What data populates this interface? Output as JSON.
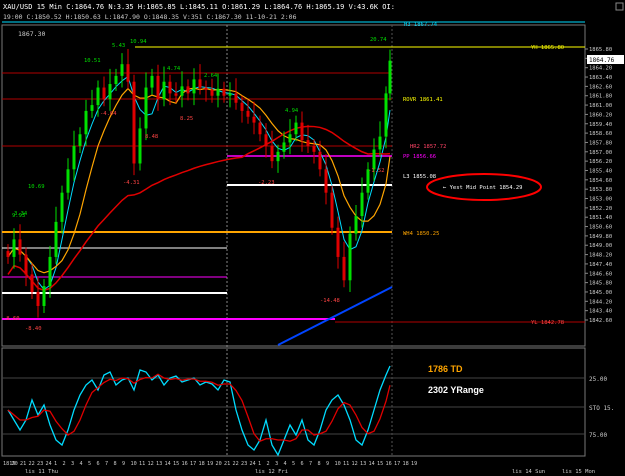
{
  "header": {
    "symbol": "XAU/USD",
    "timeframe": "15 Min",
    "quote": "C:1864.76 H:3.35 H:1865.85 L:1845.11 O:1861.29 H:1864.76 L:1845.11 ...",
    "quote_display": "XAU/USD  15 Min  C:1864.76  N:3.35  H:1865.85  L:1845.11  O:1861.29  L:1864.76  H:1865.19  V:43.6K  OI:",
    "line2": "19:00  C:1850.52  H:1850.63  L:1847.90  O:1848.35  V:351  C:1867.30  11-10-21  2:06"
  },
  "price_axis": {
    "labels": [
      "1865.80",
      "1865.00",
      "1864.76",
      "1864.20",
      "1863.40",
      "1862.60",
      "1861.80",
      "1861.00",
      "1860.20",
      "1859.40",
      "1858.60",
      "1857.80",
      "1857.00",
      "1856.20",
      "1855.40",
      "1854.60",
      "1853.80",
      "1853.00",
      "1852.20",
      "1851.40",
      "1850.60",
      "1849.80",
      "1849.00",
      "1848.20",
      "1847.40",
      "1846.60",
      "1845.80",
      "1845.00",
      "1844.20",
      "1843.40",
      "1842.60"
    ],
    "current": "1864.76",
    "osc_labels": [
      "25.00",
      "STO 15.",
      "75.00"
    ]
  },
  "levels": {
    "h3": "H3 1867.74",
    "yh": "YH 1865.80",
    "rovr": "ROVR 1861.41",
    "hr2": "HR2 1857.72",
    "pp": "PP 1856.66",
    "l3": "L3 1855.08",
    "wh4": "WH4 1850.25",
    "yl": "YL 1842.78",
    "top_left": "1867.30"
  },
  "annotations": {
    "vmp": "← Yest Mid Point 1854.29",
    "peaks": [
      "5.43",
      "10.94",
      "10.51",
      "4.74",
      "2.64",
      "4.94",
      "20.74",
      "10.69",
      "-8.40",
      "-14.48",
      "-2.23",
      "-1.52",
      "-8.60",
      "9.93",
      "3.34",
      "8.48",
      "8.25",
      "-4.31",
      "-4.04"
    ],
    "td": "1786 TD",
    "yrange": "2302 YRange"
  },
  "time_axis": {
    "ticks": [
      "1819",
      "20",
      "21",
      "22",
      "23",
      "24",
      "1",
      "2",
      "3",
      "4",
      "5",
      "6",
      "7",
      "8",
      "9",
      "10",
      "11",
      "12",
      "13",
      "14",
      "15",
      "16",
      "17",
      "18",
      "19",
      "20",
      "21",
      "22",
      "23",
      "24",
      "1",
      "2",
      "3",
      "4",
      "5",
      "6",
      "7",
      "8",
      "9",
      "10",
      "11",
      "12",
      "13",
      "14",
      "15",
      "16",
      "17",
      "18",
      "19"
    ],
    "dates": [
      "lis 11 Thu",
      "lis 12 Fri",
      "lis 14 Sun",
      "lis 15 Mon"
    ]
  },
  "colors": {
    "bg": "#000000",
    "up": "#00e000",
    "down": "#e00000",
    "yellow": "#ffff00",
    "orange": "#ffa500",
    "magenta": "#ff00ff",
    "pink": "#ff66aa",
    "blue": "#0044ff",
    "cyan": "#00dcff",
    "dkred": "#b00000",
    "grid": "#333333",
    "annot": "#ff0000"
  }
}
